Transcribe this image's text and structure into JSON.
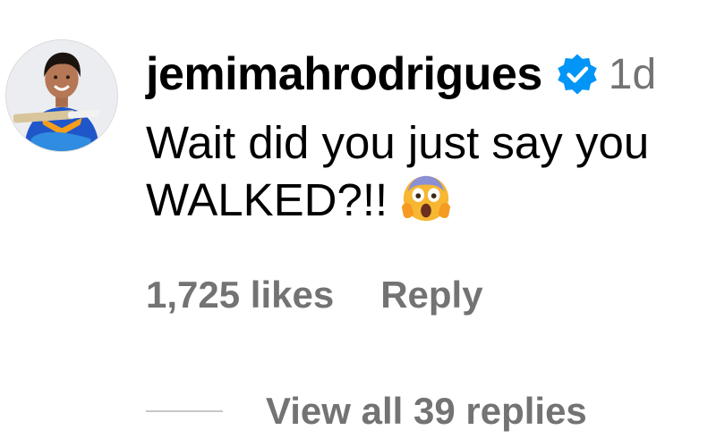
{
  "comment": {
    "username": "jemimahrodrigues",
    "verified_icon": "verified-badge-icon",
    "time": "1d",
    "text": "Wait did you just say you WALKED?!!",
    "emoji": "face-screaming-in-fear-emoji",
    "likes": "1,725 likes",
    "reply_label": "Reply",
    "view_replies_label": "View all 39 replies"
  },
  "colors": {
    "text": "#000000",
    "secondary": "#737373",
    "verified": "#0095f6",
    "divider": "#c7c7c7"
  }
}
